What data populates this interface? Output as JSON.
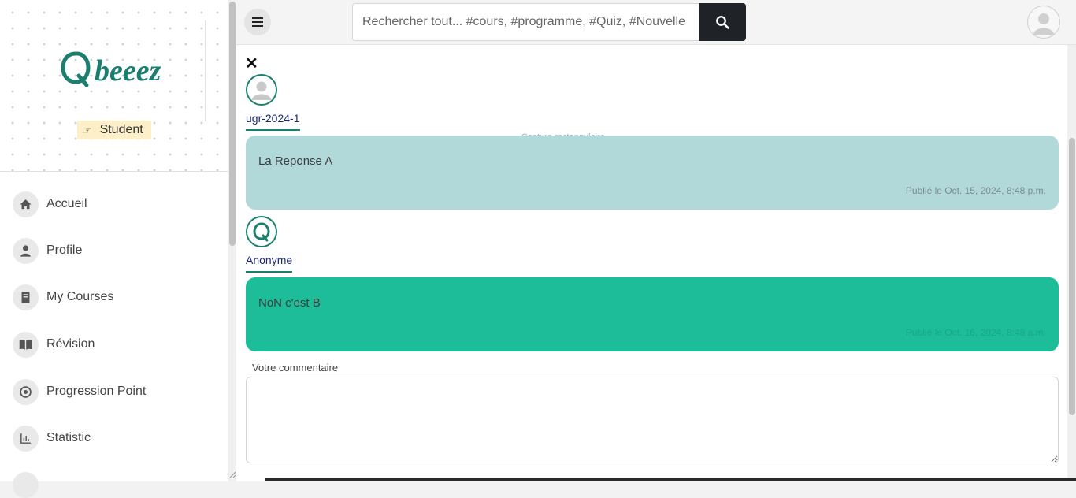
{
  "sidebar": {
    "logo_text": "beeez",
    "role": "Student",
    "items": [
      {
        "label": "Accueil",
        "icon": "home-icon"
      },
      {
        "label": "Profile",
        "icon": "person-icon"
      },
      {
        "label": "My Courses",
        "icon": "book-icon"
      },
      {
        "label": "Révision",
        "icon": "open-book-icon"
      },
      {
        "label": "Progression Point",
        "icon": "target-icon"
      },
      {
        "label": "Statistic",
        "icon": "bar-chart-icon"
      }
    ]
  },
  "topbar": {
    "search_placeholder": "Rechercher tout... #cours, #programme, #Quiz, #Nouvelle",
    "search_icon": "search-icon",
    "menu_icon": "hamburger-icon"
  },
  "thread": {
    "posts": [
      {
        "author": "ugr-2024-1",
        "text": "La Reponse A",
        "meta": "Publié le Oct. 15, 2024, 8:48 p.m."
      },
      {
        "author": "Anonyme",
        "text": "NoN c'est B",
        "meta": "Publié le Oct. 16, 2024, 8:48 a.m."
      }
    ],
    "ghost_text": "Capture rectangulaire",
    "comment_label": "Votre commentaire"
  },
  "colors": {
    "brand": "#1a7f6e",
    "bubble_question": "#b1d9da",
    "bubble_answer": "#1dbd99",
    "search_button": "#1f2226"
  }
}
